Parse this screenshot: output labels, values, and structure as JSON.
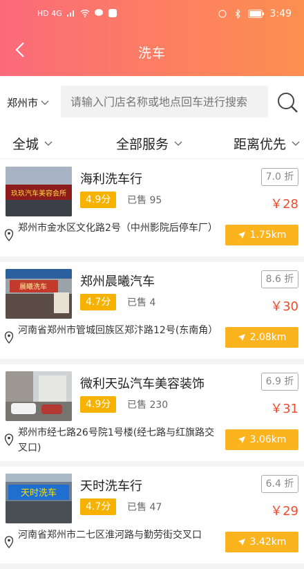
{
  "status_bar": {
    "left_label": "HD 4G",
    "time": "3:49"
  },
  "header": {
    "title": "洗车"
  },
  "search": {
    "city": "郑州市",
    "placeholder": "请输入门店名称或地点回车进行搜索"
  },
  "filters": [
    {
      "label": "全城"
    },
    {
      "label": "全部服务"
    },
    {
      "label": "距离优先"
    }
  ],
  "shops": [
    {
      "name": "海利洗车行",
      "rating": "4.9分",
      "sold": "已售 95",
      "discount": "7.0 折",
      "price": "￥28",
      "address": "郑州市金水区文化路2号（中州影院后停车厂）",
      "distance": "1.75km",
      "thumb_text": "玖玖汽车美容会所"
    },
    {
      "name": "郑州晨曦汽车",
      "rating": "4.7分",
      "sold": "已售 4",
      "discount": "8.6 折",
      "price": "￥30",
      "address": "河南省郑州市管城回族区郑汴路12号(东南角）",
      "distance": "2.08km",
      "thumb_text": "晨曦洗车"
    },
    {
      "name": "微利天弘汽车美容装饰",
      "rating": "4.9分",
      "sold": "已售 230",
      "discount": "6.9 折",
      "price": "￥31",
      "address": "郑州市经七路26号院1号楼(经七路与红旗路交叉口)",
      "distance": "3.06km",
      "thumb_text": ""
    },
    {
      "name": "天时洗车行",
      "rating": "4.7分",
      "sold": "已售 47",
      "discount": "6.4 折",
      "price": "￥29",
      "address": "河南省郑州市二七区淮河路与勤劳街交叉口",
      "distance": "3.42km",
      "thumb_text": "天时洗车"
    }
  ],
  "colors": {
    "header_start": "#fb6a7a",
    "header_end": "#fd8f50",
    "rating_bg": "#f7b200",
    "distance_bg": "#fbb41e",
    "price": "#f04a2a"
  }
}
